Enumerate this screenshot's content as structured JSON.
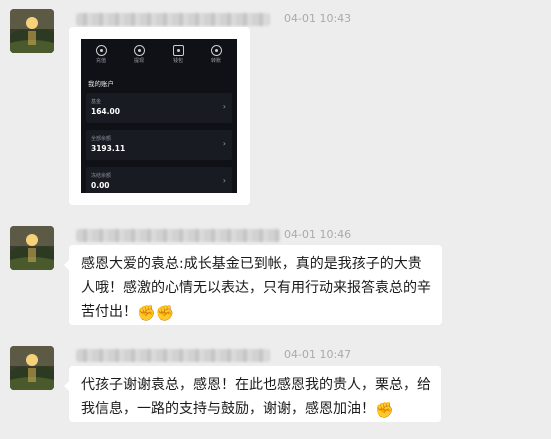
{
  "messages": [
    {
      "time": "04-01 10:43",
      "type": "image",
      "image": {
        "icons": [
          {
            "label": "充值",
            "icon": "deposit-icon"
          },
          {
            "label": "提现",
            "icon": "withdraw-icon"
          },
          {
            "label": "钱包",
            "icon": "wallet-icon"
          },
          {
            "label": "转账",
            "icon": "transfer-icon"
          }
        ],
        "title": "我的账户",
        "rows": [
          {
            "label": "基金",
            "value": "164.00"
          },
          {
            "label": "全部余额",
            "value": "3193.11"
          },
          {
            "label": "冻结余额",
            "value": "0.00"
          }
        ]
      }
    },
    {
      "time": "04-01 10:46",
      "type": "text",
      "lines": [
        "感恩大爱的袁总:成长基金已到帐，真的是我孩子的大贵",
        "人哦！感激的心情无以表达，只有用行动来报答袁总的辛",
        "苦付出！"
      ],
      "emoji": "✊✊"
    },
    {
      "time": "04-01 10:47",
      "type": "text",
      "lines": [
        "代孩子谢谢袁总，感恩！在此也感恩我的贵人，栗总，给",
        "我信息，一路的支持与鼓励，谢谢，感恩加油！"
      ],
      "emoji": "✊"
    }
  ],
  "colors": {
    "background": "#ededed",
    "bubble": "#ffffff",
    "time": "#aaaaaa",
    "phone_bg": "#0f1116"
  }
}
